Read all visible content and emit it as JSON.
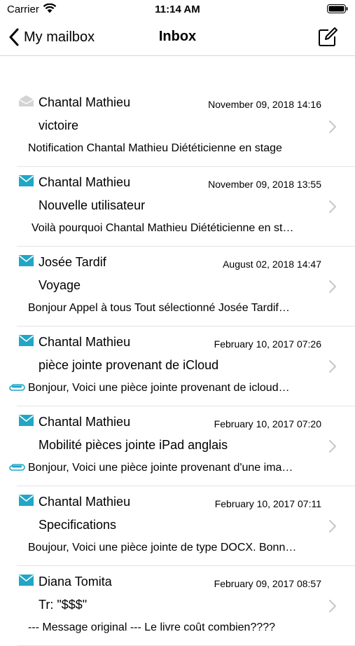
{
  "status_bar": {
    "carrier": "Carrier",
    "time": "11:14 AM"
  },
  "nav": {
    "back_label": "My mailbox",
    "title": "Inbox"
  },
  "colors": {
    "accent": "#21a6c6",
    "read_envelope": "#d4d4d4",
    "chevron": "#c7c7cc",
    "separator": "#e4e4e4"
  },
  "messages": [
    {
      "sender": "Chantal Mathieu",
      "date": "November 09, 2018 14:16",
      "subject": "victoire",
      "preview": "Notification Chantal Mathieu Diététicienne en stage",
      "read": true,
      "attachment": false
    },
    {
      "sender": "Chantal Mathieu",
      "date": "November 09, 2018 13:55",
      "subject": "Nouvelle utilisateur",
      "preview": "Voilà pourquoi Chantal Mathieu Diététicienne en st…",
      "read": false,
      "attachment": false
    },
    {
      "sender": "Josée Tardif",
      "date": "August 02, 2018 14:47",
      "subject": "Voyage",
      "preview": "Bonjour Appel à tous Tout sélectionné Josée Tardif…",
      "read": false,
      "attachment": false
    },
    {
      "sender": "Chantal Mathieu",
      "date": "February 10, 2017 07:26",
      "subject": "pièce jointe provenant de iCloud",
      "preview": "Bonjour, Voici une pièce jointe provenant de icloud…",
      "read": false,
      "attachment": true
    },
    {
      "sender": "Chantal Mathieu",
      "date": "February 10, 2017 07:20",
      "subject": "Mobilité pièces jointe iPad anglais",
      "preview": "Bonjour, Voici une pièce jointe provenant d'une ima…",
      "read": false,
      "attachment": true
    },
    {
      "sender": "Chantal Mathieu",
      "date": "February 10, 2017 07:11",
      "subject": "Specifications",
      "preview": "Boujour, Voici une pièce jointe de type DOCX. Bonn…",
      "read": false,
      "attachment": false
    },
    {
      "sender": "Diana Tomita",
      "date": "February 09, 2017 08:57",
      "subject": "Tr: \"$$$\"",
      "preview": "--- Message original --- Le livre coût combien????",
      "read": false,
      "attachment": false
    }
  ]
}
